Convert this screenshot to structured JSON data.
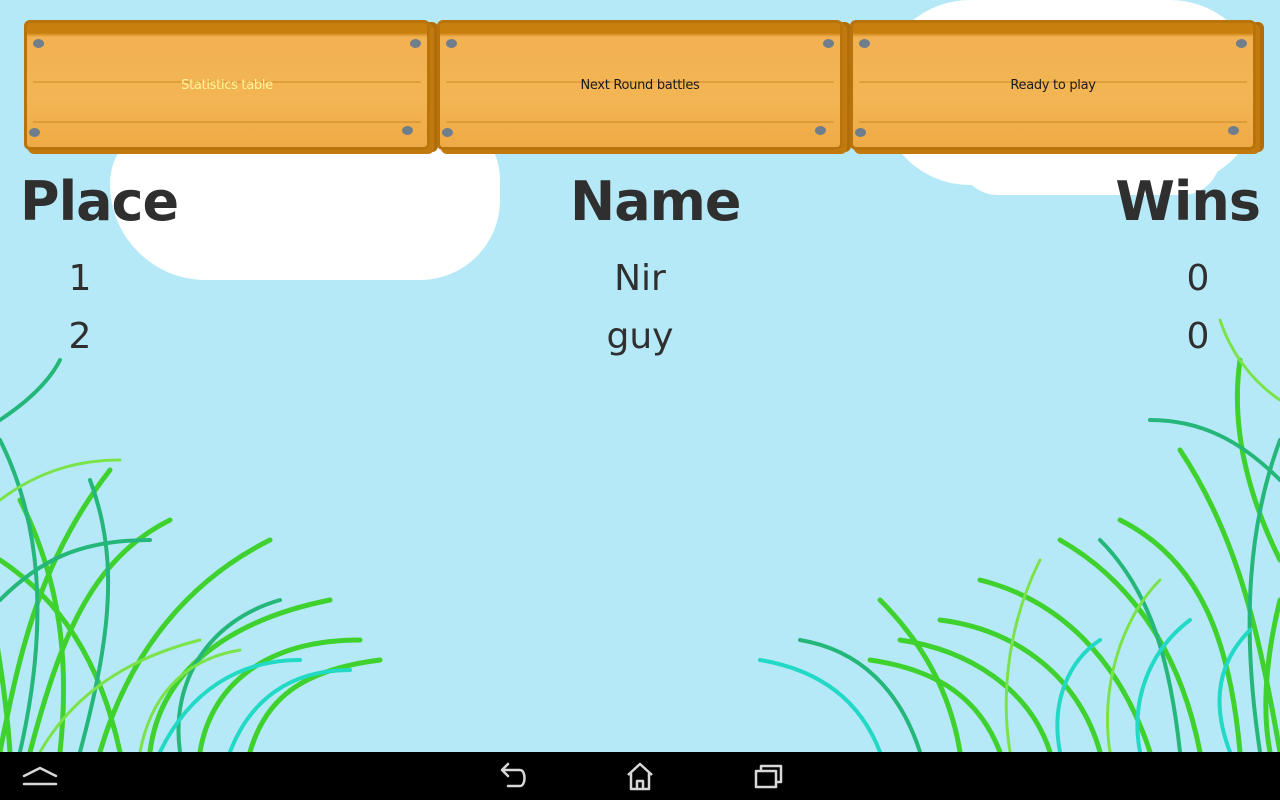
{
  "tabs": [
    {
      "label": "Statistics table",
      "color": "#fff79a",
      "active": true
    },
    {
      "label": "Next Round battles",
      "color": "#1a1a1a",
      "active": false
    },
    {
      "label": "Ready to play",
      "color": "#1a1a1a",
      "active": false
    }
  ],
  "table": {
    "headers": [
      "Place",
      "Name",
      "Wins"
    ],
    "rows": [
      {
        "place": "1",
        "name": "Nir",
        "wins": "0"
      },
      {
        "place": "2",
        "name": "guy",
        "wins": "0"
      }
    ]
  },
  "nav": {
    "icons": [
      "hide-bar-icon",
      "back-icon",
      "home-icon",
      "recent-apps-icon"
    ]
  },
  "colors": {
    "sky": "#b6e9f7",
    "plank": "#f3b554",
    "plank_edge": "#c97f0e",
    "text": "#2f2f2f"
  }
}
